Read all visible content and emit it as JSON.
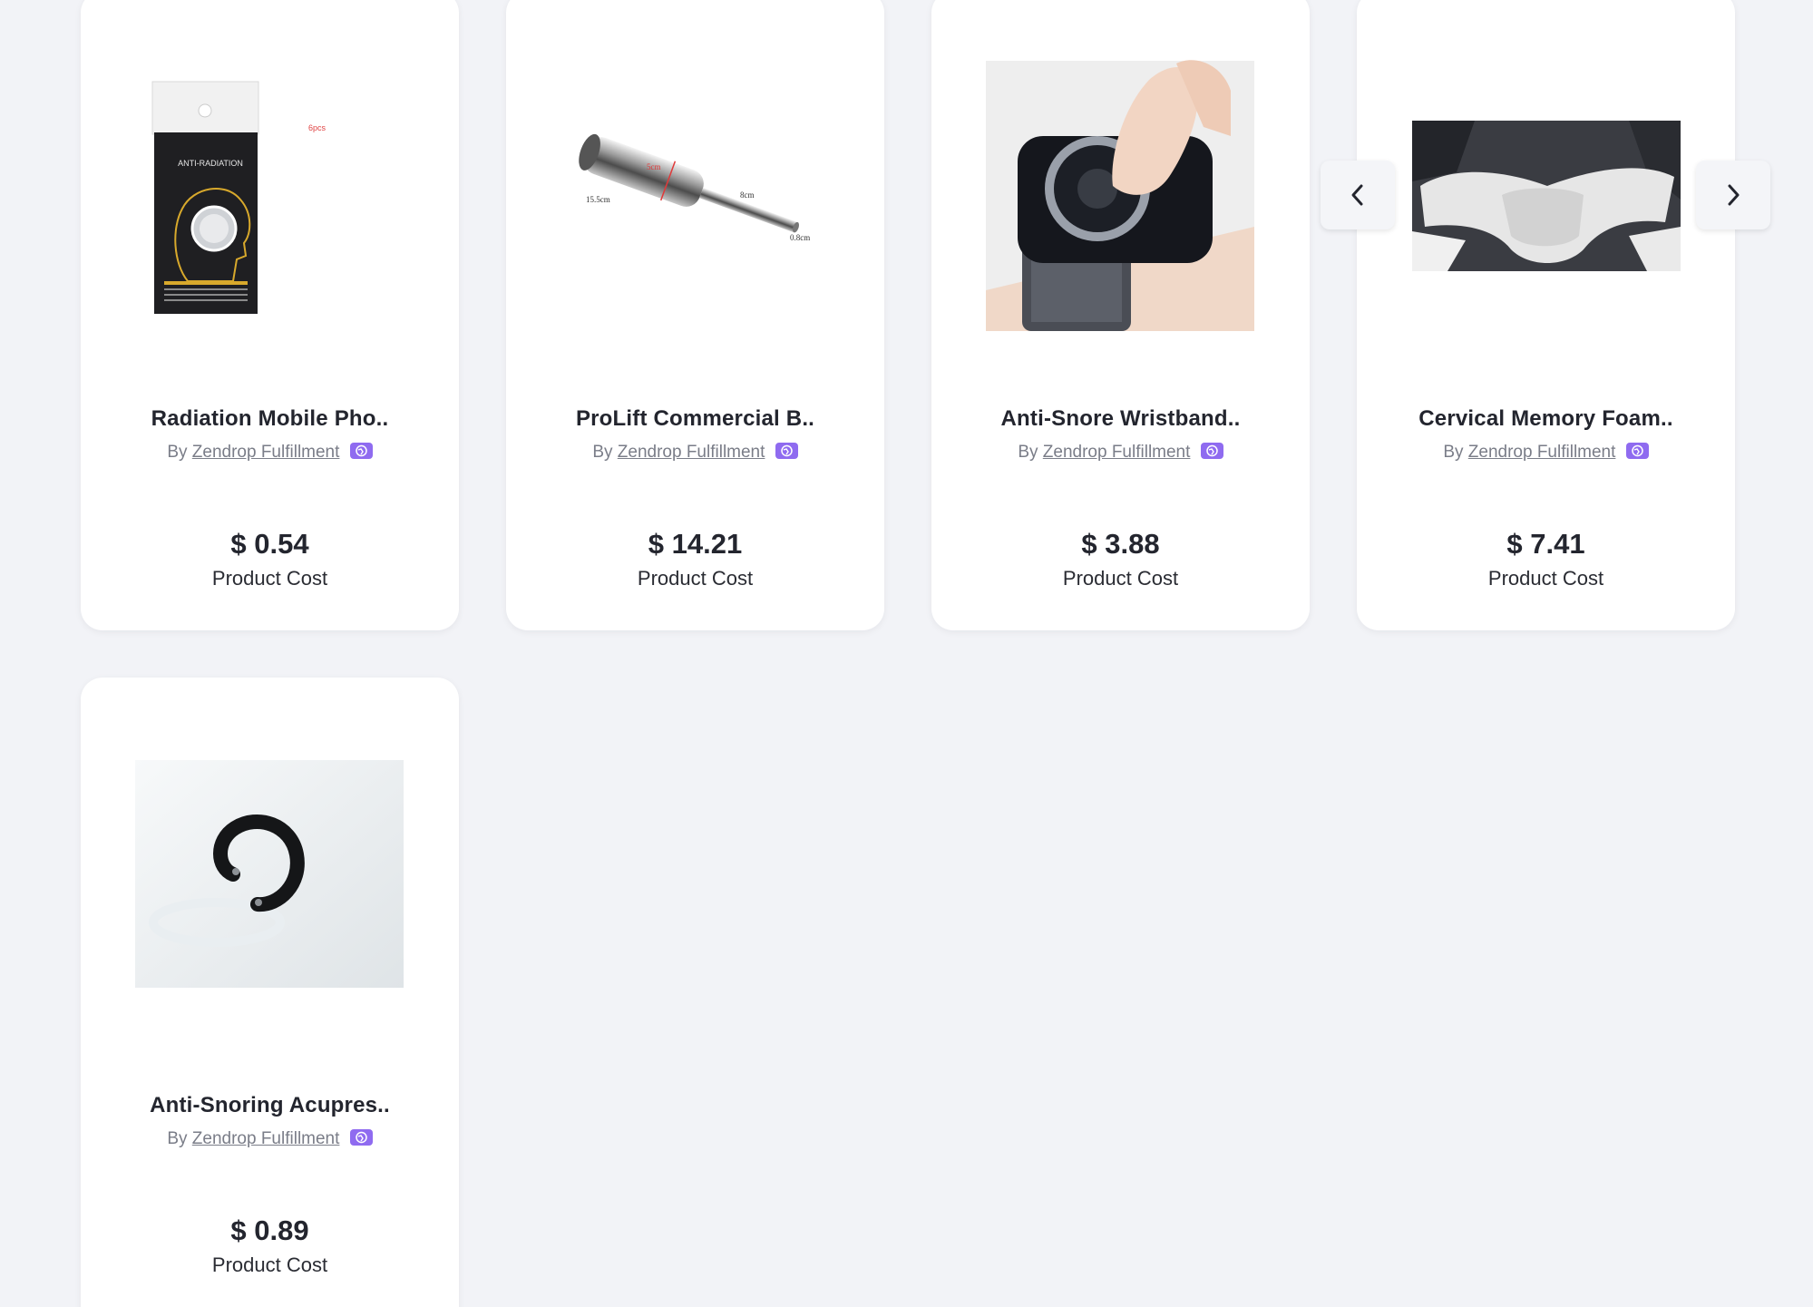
{
  "products": [
    {
      "title": "Radiation Mobile Pho..",
      "by": "By",
      "seller": "Zendrop Fulfillment",
      "price": "$ 0.54",
      "cost_label": "Product Cost",
      "image": "anti-radiation sticker pack",
      "image_text": {
        "package_label": "ANTI-RADIATION",
        "count_label": "6pcs"
      }
    },
    {
      "title": "ProLift Commercial B..",
      "by": "By",
      "seller": "Zendrop Fulfillment",
      "price": "$ 14.21",
      "cost_label": "Product Cost",
      "image": "steel bar attachment with dimensions",
      "image_text": {
        "dim_length": "15.5cm",
        "dim_width": "5cm",
        "dim_rod": "8cm",
        "dim_tip": "0.8cm"
      }
    },
    {
      "title": "Anti-Snore Wristband..",
      "by": "By",
      "seller": "Zendrop Fulfillment",
      "price": "$ 3.88",
      "cost_label": "Product Cost",
      "image": "wrist device being pressed"
    },
    {
      "title": "Cervical Memory Foam..",
      "by": "By",
      "seller": "Zendrop Fulfillment",
      "price": "$ 7.41",
      "cost_label": "Product Cost",
      "image": "white memory foam pillow"
    },
    {
      "title": "Anti-Snoring Acupres..",
      "by": "By",
      "seller": "Zendrop Fulfillment",
      "price": "$ 0.89",
      "cost_label": "Product Cost",
      "image": "black magnetic ring"
    }
  ],
  "carousel": {
    "prev_icon": "chevron-left-icon",
    "next_icon": "chevron-right-icon"
  },
  "colors": {
    "background": "#f2f3f7",
    "card": "#ffffff",
    "badge": "#8f6bf0",
    "text_dark": "#23252e",
    "text_muted": "#7a7d88"
  }
}
